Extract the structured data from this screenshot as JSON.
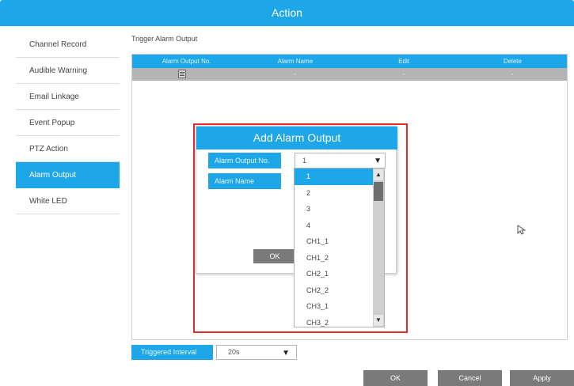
{
  "window": {
    "title": "Action"
  },
  "sidebar": {
    "items": [
      {
        "label": "Channel Record"
      },
      {
        "label": "Audible Warning"
      },
      {
        "label": "Email Linkage"
      },
      {
        "label": "Event Popup"
      },
      {
        "label": "PTZ Action"
      },
      {
        "label": "Alarm Output",
        "active": true
      },
      {
        "label": "White LED"
      }
    ]
  },
  "section": {
    "label": "Trigger Alarm Output"
  },
  "table": {
    "headers": [
      "Alarm Output No.",
      "Alarm Name",
      "Edit",
      "Delete"
    ],
    "rows": [
      {
        "add_icon": "add-row-icon",
        "alarm_name": "-",
        "edit": "-",
        "delete": "-"
      }
    ]
  },
  "dialog": {
    "title": "Add Alarm Output",
    "output_no_label": "Alarm Output No.",
    "output_no_value": "1",
    "alarm_name_label": "Alarm Name",
    "ok_label": "OK",
    "dropdown_options": [
      "1",
      "2",
      "3",
      "4",
      "CH1_1",
      "CH1_2",
      "CH2_1",
      "CH2_2",
      "CH3_1",
      "CH3_2"
    ],
    "dropdown_selected": "1"
  },
  "interval": {
    "label": "Triggered Interval",
    "value": "20s"
  },
  "footer": {
    "ok_label": "OK",
    "cancel_label": "Cancel",
    "apply_label": "Apply"
  },
  "colors": {
    "accent": "#1da7e8",
    "highlight": "#e52a2a",
    "button": "#7a7a7a"
  }
}
